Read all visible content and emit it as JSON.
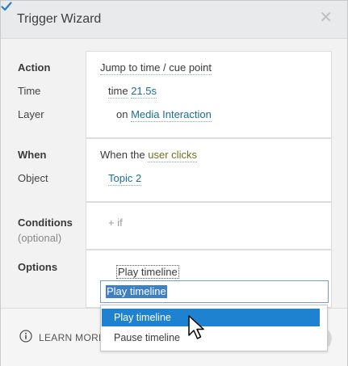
{
  "window": {
    "title": "Trigger Wizard",
    "close_glyph": "✕"
  },
  "labels": {
    "action": "Action",
    "time": "Time",
    "layer": "Layer",
    "when": "When",
    "object": "Object",
    "conditions": "Conditions",
    "conditions_sub": "(optional)",
    "options": "Options"
  },
  "action_panel": {
    "action_value": "Jump to time / cue point",
    "time_prefix": "time",
    "time_value": "21.5s",
    "layer_prefix": "on",
    "layer_value": "Media Interaction"
  },
  "when_panel": {
    "when_prefix": "When the",
    "when_value": "user clicks",
    "object_value": "Topic 2"
  },
  "conditions_panel": {
    "add_label": "+ if"
  },
  "options_panel": {
    "checkbox_checked": true,
    "select_value": "Play timeline",
    "input_value": "Play timeline",
    "menu_items": [
      {
        "label": "Play timeline",
        "highlighted": true
      },
      {
        "label": "Pause timeline",
        "highlighted": false
      }
    ]
  },
  "footer": {
    "learn_more": "LEARN MORE"
  },
  "colors": {
    "link": "#1a6f8f",
    "highlight": "#1f82d1",
    "olive": "#6b7322"
  }
}
